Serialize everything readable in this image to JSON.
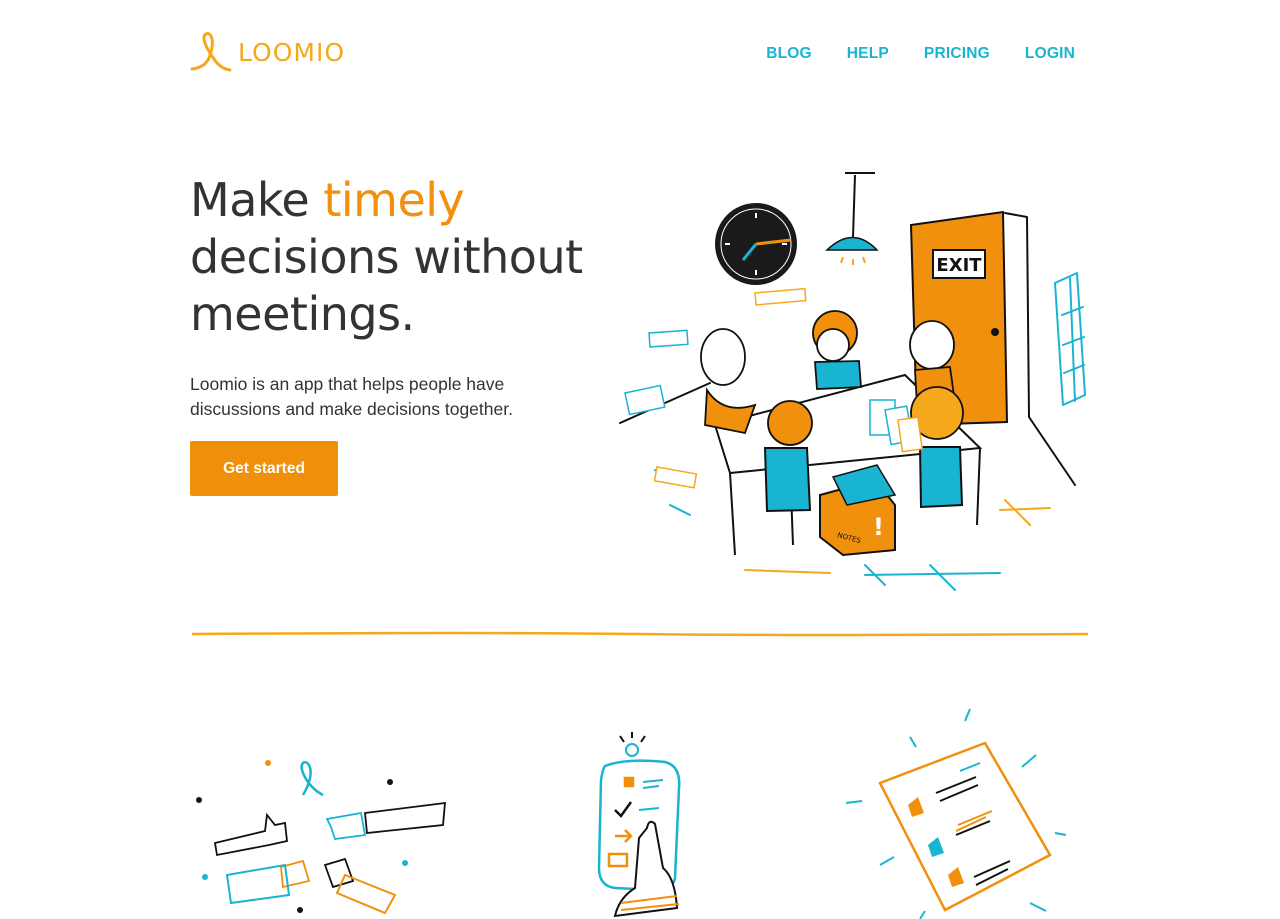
{
  "header": {
    "logo_text": "LOOMIO",
    "nav": {
      "blog": "BLOG",
      "help": "HELP",
      "pricing": "PRICING",
      "login": "LOGIN"
    }
  },
  "hero": {
    "headline_pre": "Make ",
    "headline_accent": "timely",
    "headline_post": " decisions without meetings.",
    "subtitle": "Loomio is an app that helps people have discussions and make decisions together.",
    "cta_label": "Get started",
    "illustration": {
      "sign_text": "EXIT",
      "box_text": "NOTES"
    }
  },
  "features": {
    "icons": [
      "thumbs-up-hands-icon",
      "phone-notifications-icon",
      "document-votes-icon"
    ]
  },
  "colors": {
    "accent_orange": "#ef8f0a",
    "logo_orange": "#f6a81c",
    "nav_cyan": "#19b4d1",
    "text_dark": "#333333"
  }
}
